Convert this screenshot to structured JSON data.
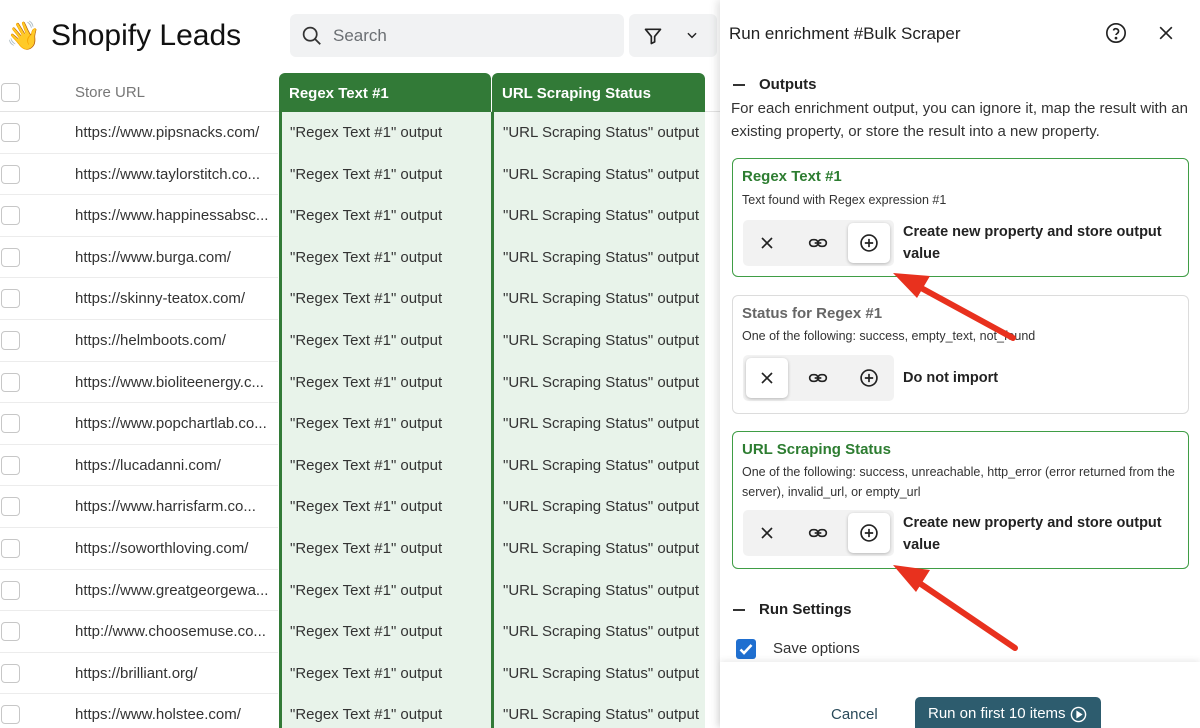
{
  "app": {
    "emoji": "👋",
    "title": "Shopify Leads"
  },
  "search": {
    "placeholder": "Search"
  },
  "table": {
    "columns": [
      "Store URL",
      "Regex Text #1",
      "URL Scraping Status"
    ],
    "rows": [
      {
        "url": "https://www.pipsnacks.com/",
        "regex": "\"Regex Text #1\" output",
        "status": "\"URL Scraping Status\" output"
      },
      {
        "url": "https://www.taylorstitch.co...",
        "regex": "\"Regex Text #1\" output",
        "status": "\"URL Scraping Status\" output"
      },
      {
        "url": "https://www.happinessabsc...",
        "regex": "\"Regex Text #1\" output",
        "status": "\"URL Scraping Status\" output"
      },
      {
        "url": "https://www.burga.com/",
        "regex": "\"Regex Text #1\" output",
        "status": "\"URL Scraping Status\" output"
      },
      {
        "url": "https://skinny-teatox.com/",
        "regex": "\"Regex Text #1\" output",
        "status": "\"URL Scraping Status\" output"
      },
      {
        "url": "https://helmboots.com/",
        "regex": "\"Regex Text #1\" output",
        "status": "\"URL Scraping Status\" output"
      },
      {
        "url": "https://www.bioliteenergy.c...",
        "regex": "\"Regex Text #1\" output",
        "status": "\"URL Scraping Status\" output"
      },
      {
        "url": "https://www.popchartlab.co...",
        "regex": "\"Regex Text #1\" output",
        "status": "\"URL Scraping Status\" output"
      },
      {
        "url": "https://lucadanni.com/",
        "regex": "\"Regex Text #1\" output",
        "status": "\"URL Scraping Status\" output"
      },
      {
        "url": "https://www.harrisfarm.co...",
        "regex": "\"Regex Text #1\" output",
        "status": "\"URL Scraping Status\" output"
      },
      {
        "url": "https://soworthloving.com/",
        "regex": "\"Regex Text #1\" output",
        "status": "\"URL Scraping Status\" output"
      },
      {
        "url": "https://www.greatgeorgewa...",
        "regex": "\"Regex Text #1\" output",
        "status": "\"URL Scraping Status\" output"
      },
      {
        "url": "http://www.choosemuse.co...",
        "regex": "\"Regex Text #1\" output",
        "status": "\"URL Scraping Status\" output"
      },
      {
        "url": "https://brilliant.org/",
        "regex": "\"Regex Text #1\" output",
        "status": "\"URL Scraping Status\" output"
      },
      {
        "url": "https://www.holstee.com/",
        "regex": "\"Regex Text #1\" output",
        "status": "\"URL Scraping Status\" output"
      }
    ]
  },
  "panel": {
    "title": "Run enrichment #Bulk Scraper",
    "outputs_heading": "Outputs",
    "outputs_description": "For each enrichment output, you can ignore it, map the result with an existing property, or store the result into a new property.",
    "cards": [
      {
        "title": "Regex Text #1",
        "subtitle": "Text found with Regex expression #1",
        "selected": "create",
        "choice_text": "Create new property and store output value"
      },
      {
        "title": "Status for Regex #1",
        "subtitle": "One of the following: success, empty_text, not_found",
        "selected": "ignore",
        "choice_text": "Do not import"
      },
      {
        "title": "URL Scraping Status",
        "subtitle": "One of the following: success, unreachable, http_error (error returned from the server), invalid_url, or empty_url",
        "selected": "create",
        "choice_text": "Create new property and store output value"
      }
    ],
    "run_settings_heading": "Run Settings",
    "save_options_label": "Save options",
    "save_options_checked": true,
    "cancel_label": "Cancel",
    "run_label": "Run on first 10 items"
  },
  "colors": {
    "green_header": "#327a37",
    "green_tint": "#e8f3ea",
    "run_button": "#2d5c6e",
    "arrow": "#e8311e"
  }
}
